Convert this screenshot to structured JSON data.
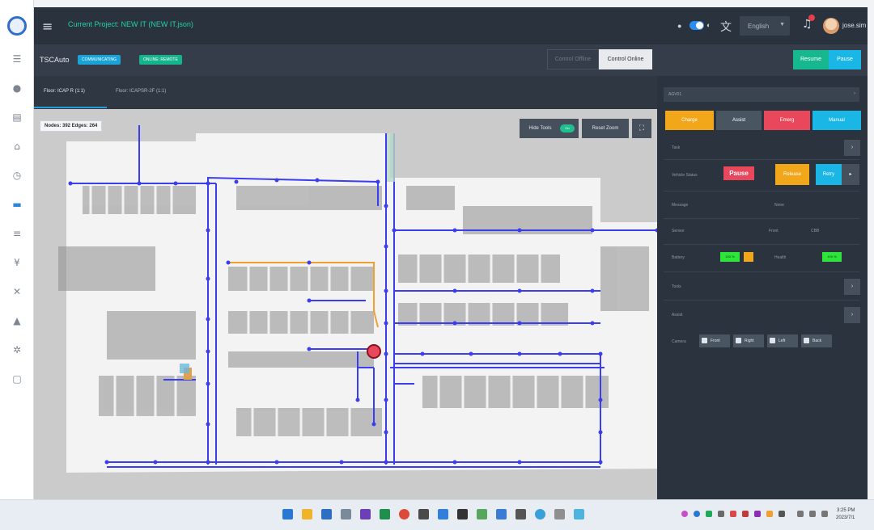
{
  "app": {
    "project_title": "Current Project: NEW IT (NEW IT.json)",
    "app_name": "TSCAuto",
    "status_pills": [
      "COMMUNICATING",
      "ONLINE: REMOTE"
    ],
    "language": "English",
    "user_name": "jose.sim",
    "notification_count": 1
  },
  "control": {
    "offline_label": "Control Offline",
    "online_label": "Control Online",
    "resume_label": "Resume",
    "pause_label": "Pause"
  },
  "floor_tabs": [
    "Floor: ICAP R (1:1)",
    "Floor: ICAPSR-2F (1:1)"
  ],
  "map": {
    "counts_text": "Nodes: 392   Edges: 264",
    "hide_tools_label": "Hide Tools",
    "hide_tools_state": "On",
    "reset_zoom_label": "Reset Zoom"
  },
  "panel": {
    "vehicle_select": "AGV01",
    "modes": [
      {
        "label": "Charge",
        "color": "#f2a61a"
      },
      {
        "label": "Assist",
        "color": "#4a5562"
      },
      {
        "label": "Emerg",
        "color": "#e8475c"
      },
      {
        "label": "Manual",
        "color": "#19b6e6"
      }
    ],
    "task_label": "Task",
    "vehicle_status_label": "Vehicle Status",
    "vehicle_status_value": "Pause",
    "release_label": "Release",
    "retry_label": "Retry",
    "message_label": "Message",
    "message_value": "None",
    "sensor_label": "Sensor",
    "sensor_value_1": "Front",
    "sensor_value_2": "CBB",
    "battery_label": "Battery",
    "battery_value": "100 %",
    "health_label": "Health",
    "health_value": "100 %",
    "tools_label": "Tools",
    "assist_label": "Assist",
    "camera_label": "Camera",
    "cameras": [
      "Front",
      "Right",
      "Left",
      "Back"
    ]
  },
  "taskbar": {
    "time": "3:25 PM",
    "date": "2023/7/1"
  }
}
